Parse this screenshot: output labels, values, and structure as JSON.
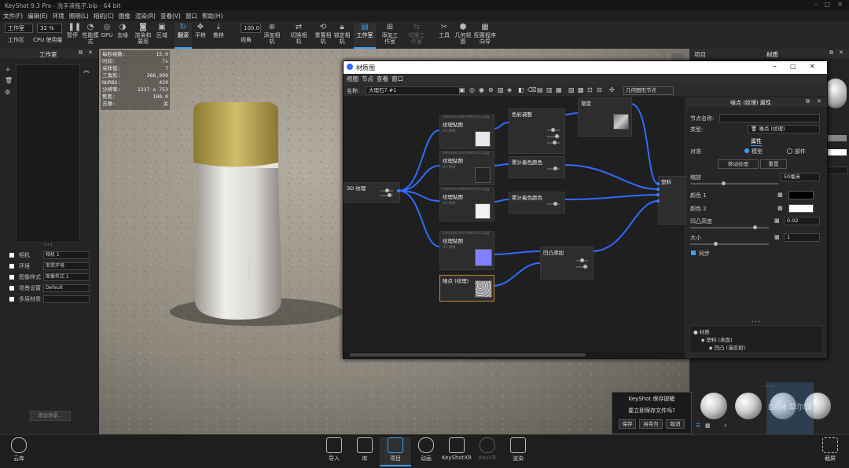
{
  "window": {
    "title": "KeyShot 9.3 Pro  - 洗手液瓶子.bip  - 64 bit"
  },
  "menu": [
    "文件(F)",
    "编辑(E)",
    "环境",
    "照明(L)",
    "相机(C)",
    "图像",
    "渲染(R)",
    "查看(V)",
    "窗口",
    "帮助(H)"
  ],
  "toolbar": {
    "workspace_select": "工作室",
    "workspace_label": "工作区",
    "cpu_value": "32 %",
    "cpu_label": "CPU 使用量",
    "zoom_value": "100.0",
    "buttons": [
      "暂停",
      "性能模式",
      "GPU",
      "去噪",
      "渲染和展现",
      "区域",
      "翻滚",
      "平移",
      "推移",
      "视角",
      "添加相机",
      "切换相机",
      "重置相机",
      "锁定相机",
      "工作室",
      "添加工作室",
      "切换工作室",
      "工具",
      "几何视图",
      "配置程序向导"
    ],
    "active": [
      "翻滚",
      "工作室"
    ]
  },
  "left_panel": {
    "title": "工作室",
    "rows": [
      {
        "label": "相机",
        "value": "相机 1"
      },
      {
        "label": "环境",
        "value": "渐变环境"
      },
      {
        "label": "图像样式",
        "value": "图像样式 1"
      },
      {
        "label": "场景设置",
        "value": "Default"
      },
      {
        "label": "多层材质",
        "value": ""
      }
    ],
    "button": "添加场景..."
  },
  "hud": {
    "rows": [
      {
        "k": "每秒帧数:",
        "v": "15.0"
      },
      {
        "k": "时间:",
        "v": "7s"
      },
      {
        "k": "采样值:",
        "v": "7"
      },
      {
        "k": "三角形:",
        "v": "366,990"
      },
      {
        "k": "NURBS:",
        "v": "420"
      },
      {
        "k": "分辨率:",
        "v": "1337 x 753"
      },
      {
        "k": "焦距:",
        "v": "100.0"
      },
      {
        "k": "去噪:",
        "v": "关"
      }
    ]
  },
  "material_window": {
    "title": "材质图",
    "menu": [
      "视图",
      "节点",
      "查看",
      "窗口"
    ],
    "name_label": "名称:",
    "name_value": "大理石7 #1",
    "geometry_button": "几何图形节点",
    "nodes": {
      "n_3d": "3D 纹理",
      "n_color_adjust": "色彩调整",
      "n_gradient": "渐变",
      "n_tex1": "纹理贴图",
      "n_tex2": "纹理贴图",
      "n_tex3": "纹理贴图",
      "n_tex4": "纹理贴图",
      "n_blend1": "累计着色颜色",
      "n_blend2": "累计着色颜色",
      "n_bump": "凹凸添加",
      "n_noise": "噪点 (纹理)",
      "n_material": "塑料",
      "n_sub": "Diffuse/Color/Metal (1).jpg",
      "n_map_label": "UV 映射"
    },
    "props": {
      "header": "噪点 (纹理)  属性",
      "node_name_label": "节点名称:",
      "node_name_value": "",
      "type_label": "类型:",
      "type_value": "噪点 (纹理)",
      "tab": "属性",
      "mapping_label": "对准",
      "radio_model": "模型",
      "radio_part": "部件",
      "move_button": "移动纹理",
      "reset_button": "重置",
      "scale_label": "缩放",
      "scale_value": "50毫米",
      "color1_label": "颜色 1",
      "color2_label": "颜色 2",
      "bump_label": "凹凸高度",
      "bump_value": "0.02",
      "size_label": "大小",
      "size_value": "1",
      "sync_label": "同步",
      "tree": [
        "材质",
        "塑料 (表面)",
        "凹凸 (漫反射)"
      ]
    }
  },
  "right_panel": {
    "tabs": [
      "项目",
      "材质"
    ]
  },
  "dialog": {
    "title": "KeyShot 保存提醒",
    "message": "要立即保存文件吗?",
    "buttons": [
      "保存",
      "另存为",
      "取消"
    ]
  },
  "bottom_bar": {
    "left": "云库",
    "items": [
      "导入",
      "库",
      "项目",
      "动画",
      "KeyShotXR",
      "KeyVR",
      "渲染"
    ],
    "active": "项目",
    "right": "截屏"
  },
  "watermark": "DRM 草尔课",
  "colors": {
    "accent": "#3aa0ff",
    "node_port": "#3f7bff",
    "wire": "#2f6bff"
  }
}
